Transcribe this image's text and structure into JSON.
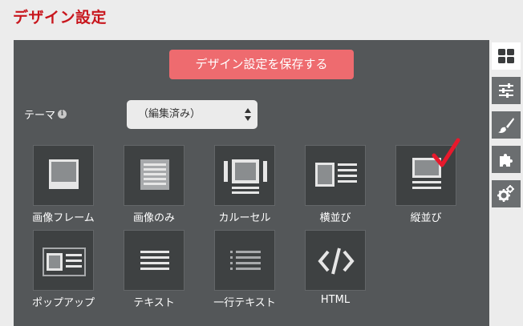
{
  "page": {
    "title": "デザイン設定"
  },
  "toolbar": {
    "save_label": "デザイン設定を保存する"
  },
  "theme": {
    "label": "テーマ",
    "info_icon": "info-icon",
    "selected": "（編集済み）"
  },
  "layouts": [
    {
      "id": "image-frame",
      "label": "画像フレーム",
      "icon": "image-frame-icon",
      "selected": false
    },
    {
      "id": "image-only",
      "label": "画像のみ",
      "icon": "image-only-icon",
      "selected": false
    },
    {
      "id": "carousel",
      "label": "カルーセル",
      "icon": "carousel-icon",
      "selected": false
    },
    {
      "id": "horizontal",
      "label": "横並び",
      "icon": "horizontal-layout-icon",
      "selected": false
    },
    {
      "id": "vertical",
      "label": "縦並び",
      "icon": "vertical-layout-icon",
      "selected": true
    },
    {
      "id": "popup",
      "label": "ポップアップ",
      "icon": "popup-icon",
      "selected": false
    },
    {
      "id": "text",
      "label": "テキスト",
      "icon": "text-lines-icon",
      "selected": false
    },
    {
      "id": "one-line-text",
      "label": "一行テキスト",
      "icon": "list-lines-icon",
      "selected": false
    },
    {
      "id": "html",
      "label": "HTML",
      "icon": "code-icon",
      "selected": false
    }
  ],
  "side_tabs": [
    {
      "icon": "grid-icon",
      "active": true
    },
    {
      "icon": "sliders-icon",
      "active": false
    },
    {
      "icon": "paintbrush-icon",
      "active": false
    },
    {
      "icon": "puzzle-icon",
      "active": false
    },
    {
      "icon": "gears-icon",
      "active": false
    }
  ],
  "colors": {
    "title": "#c8161d",
    "save_button": "#ee6b6f",
    "panel": "#545759",
    "checkmark": "#e8192c"
  }
}
